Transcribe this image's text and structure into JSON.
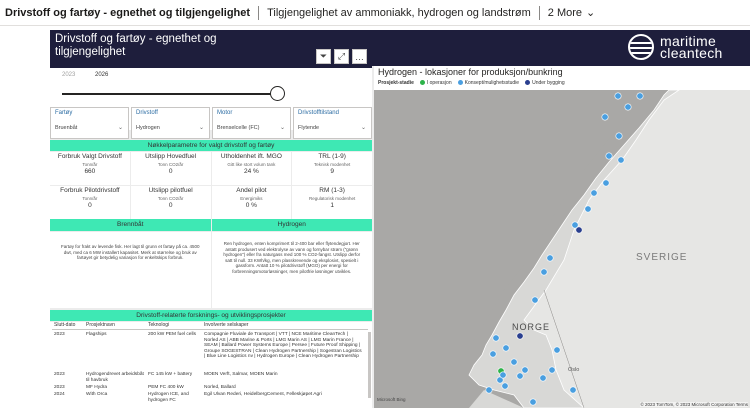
{
  "tabs": [
    "Drivstoff og fartøy - egnethet og tilgjengelighet",
    "Tilgjengelighet av ammoniakk, hydrogen og landstrøm",
    "2 More"
  ],
  "report": {
    "title": "Drivstoff og fartøy - egnethet og tilgjengelighet",
    "year_start": "2023",
    "year_end": "2026",
    "slider_value": 1.0,
    "filters": [
      {
        "label": "Fartøy",
        "value": "Bruenbåt"
      },
      {
        "label": "Drivstoff",
        "value": "Hydrogen"
      },
      {
        "label": "Motor",
        "value": "Brenselcelle (FC)"
      },
      {
        "label": "Drivstofftilstand",
        "value": "Flytende"
      }
    ],
    "section_key": "Nøkkelparametre for valgt drivstoff og fartøy",
    "kpi_row1": [
      {
        "title": "Forbruk Valgt Drivstoff",
        "sub": "Tonn/år",
        "value": "660"
      },
      {
        "title": "Utslipp Hovedfuel",
        "sub": "Tonn CO2/år",
        "value": "0"
      },
      {
        "title": "Utholdenhet ift. MGO",
        "sub": "Gitt like stort volum tank",
        "value": "24 %"
      },
      {
        "title": "TRL (1-9)",
        "sub": "Teknisk modenhet",
        "value": "9"
      }
    ],
    "kpi_row2": [
      {
        "title": "Forbruk Pilotdrivstoff",
        "sub": "Tonn/år",
        "value": "0"
      },
      {
        "title": "Utslipp pilotfuel",
        "sub": "Tonn CO2/år",
        "value": "0"
      },
      {
        "title": "Andel pilot",
        "sub": "Energimiks",
        "value": "0 %"
      },
      {
        "title": "RM (1-3)",
        "sub": "Regulatorisk modenhet",
        "value": "1"
      }
    ],
    "vessel_title": "Brennbåt",
    "fuel_title": "Hydrogen",
    "vessel_text": "Fartøy for frakt av levende fisk. Her lagt til grunn et fartøy på ca. 4500 dwt, med ca 6 MW installert kapasitet. Merk at størrelse og bruk av fartøyet gir betydelig variasjon for enkeltskips forbruk.",
    "fuel_text": "Ren hydrogen, enten komprimert til 2-400 bar eller flytendegjort. Her antatt produsert ved elektrolyse av vann og fornybar strøm (\"grønn hydrogen\") eller fra naturgass med 100 % CO2-fangst. Utslipp derfor satt til null. 33 KWh/kg, men plasskrevende og eksplosivt, spesielt i gassform. Antatt 10 % pilotdrivstoff (MGO) per energi for forbrenningsmotorløsninger, men pilotfrie løsninger utvikles.",
    "projects_title": "Drivstoff-relaterte forsknings- og utviklingsprosjekter",
    "projects_headers": [
      "Slutt-dato",
      "Prosjektnavn",
      "Teknologi",
      "Involverte selskaper"
    ],
    "projects": [
      {
        "year": "2023",
        "name": "Flagships",
        "tech": "200 kW PEM fuel cells",
        "companies": "Compagnie Fluviale de Transport | VTT | NCE Maritime CleanTech | Norled AS | ABB Marine & Ports | LMG Marin AS | LMG Marin France | SEAM | Ballard Power Systems Europe | Persee | Future Proof Shipping | Groupe SOGESTRAN | Clean Hydrogen Partnership | Sogestran Logistics | Blue Line Logistics nv | Hydrogen Europe | Clean Hydrogen Partnership"
      },
      {
        "year": "2023",
        "name": "Hydrogendrevet arbeidsbåt til havbruk",
        "tech": "FC 145 kW + battery",
        "companies": "MOEN Verft, Salmar, MOEN Marin"
      },
      {
        "year": "2023",
        "name": "MF Hydra",
        "tech": "PEM FC 400 kW",
        "companies": "Norled, Ballard"
      },
      {
        "year": "2024",
        "name": "With Orca",
        "tech": "Hydrogen ICE, and hydrogen FC",
        "companies": "Egil Ulvan Rederi, HeidelbergCement, Felleskjøpet Agri"
      }
    ]
  },
  "brand": {
    "line1": "maritime",
    "line2": "cleantech"
  },
  "map": {
    "title": "Hydrogen - lokasjoner for produksjon/bunkring",
    "legend_title": "Prosjekt-stadie",
    "legend": [
      {
        "label": "I operasjon",
        "color": "#2db34a"
      },
      {
        "label": "Konsept/mulighetsstudie",
        "color": "#4a9fe0"
      },
      {
        "label": "Under bygging",
        "color": "#2a3f8f"
      }
    ],
    "label_sverige": "SVERIGE",
    "label_norge": "NORGE",
    "label_oslo": "Oslo",
    "attribution": "© 2023 TomTom, © 2023 Microsoft Corporation Terms",
    "provider": "Microsoft Bing"
  },
  "colors": {
    "header": "#1e1e3c",
    "accent": "#3ee8b4"
  }
}
